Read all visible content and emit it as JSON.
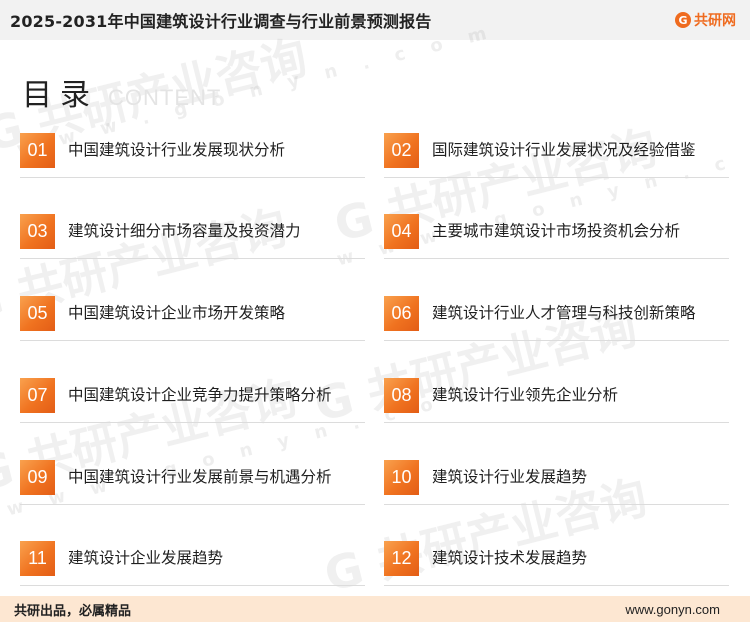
{
  "header": {
    "title": "2025-2031年中国建筑设计行业调查与行业前景预测报告",
    "brand_icon": "G",
    "brand_text": "共研网"
  },
  "watermark": {
    "text": "G 共研产业咨询",
    "url": "w w w . g o n y n . c o m"
  },
  "toc": {
    "title_cn": "目录",
    "title_en": "CONTENT",
    "accent_color": "#f07320",
    "items": [
      {
        "num": "01",
        "label": "中国建筑设计行业发展现状分析"
      },
      {
        "num": "02",
        "label": "国际建筑设计行业发展状况及经验借鉴"
      },
      {
        "num": "03",
        "label": "建筑设计细分市场容量及投资潜力"
      },
      {
        "num": "04",
        "label": "主要城市建筑设计市场投资机会分析"
      },
      {
        "num": "05",
        "label": "中国建筑设计企业市场开发策略"
      },
      {
        "num": "06",
        "label": "建筑设计行业人才管理与科技创新策略"
      },
      {
        "num": "07",
        "label": "中国建筑设计企业竞争力提升策略分析"
      },
      {
        "num": "08",
        "label": "建筑设计行业领先企业分析"
      },
      {
        "num": "09",
        "label": "中国建筑设计行业发展前景与机遇分析"
      },
      {
        "num": "10",
        "label": "建筑设计行业发展趋势"
      },
      {
        "num": "11",
        "label": "建筑设计企业发展趋势"
      },
      {
        "num": "12",
        "label": "建筑设计技术发展趋势"
      }
    ]
  },
  "footer": {
    "slogan": "共研出品，必属精品",
    "website": "www.gonyn.com"
  }
}
